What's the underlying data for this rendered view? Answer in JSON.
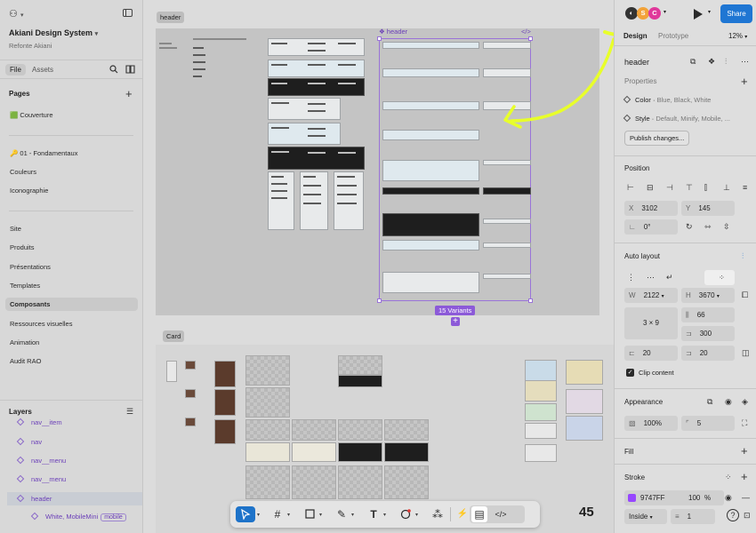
{
  "left_panel": {
    "logo": "⚇",
    "project_name": "Akiani Design System",
    "project_subtitle": "Refonte Akiani",
    "tabs": {
      "file": "File",
      "assets": "Assets"
    },
    "pages_header": "Pages",
    "pages": [
      {
        "label": "🟩 Couverture"
      },
      {
        "label": "🔑 01 - Fondamentaux"
      },
      {
        "label": "Couleurs"
      },
      {
        "label": "Iconographie"
      },
      {
        "label": "Site"
      },
      {
        "label": "Produits"
      },
      {
        "label": "Présentations"
      },
      {
        "label": "Templates"
      },
      {
        "label": "Composants"
      },
      {
        "label": "Ressources visuelles"
      },
      {
        "label": "Animation"
      },
      {
        "label": "Audit RAO"
      }
    ],
    "layers_header": "Layers",
    "layers": [
      {
        "label": "nav__item"
      },
      {
        "label": "nav"
      },
      {
        "label": "nav__menu"
      },
      {
        "label": "nav__menu"
      },
      {
        "label": "header"
      },
      {
        "label": "White, MobileMini",
        "tag": "mobile"
      }
    ]
  },
  "canvas": {
    "header_frame_label": "header",
    "selection_label": "❖ header",
    "code_icon": "</>",
    "variants_badge": "15 Variants",
    "card_frame_label": "Card",
    "zoom_count": "45"
  },
  "toolbar": {
    "tools": [
      "move-tool",
      "frame-tool",
      "shape-tool",
      "pen-tool",
      "text-tool",
      "comment-tool",
      "actions-tool"
    ]
  },
  "right_panel": {
    "avatars": [
      {
        "initial": "S",
        "color": "#f2a33a"
      },
      {
        "initial": "C",
        "color": "#e0399b"
      }
    ],
    "share_label": "Share",
    "tabs": {
      "design": "Design",
      "prototype": "Prototype"
    },
    "zoom": "12%",
    "component_name": "header",
    "properties_title": "Properties",
    "properties": [
      {
        "name": "Color",
        "values": "Blue, Black, White"
      },
      {
        "name": "Style",
        "values": "Default, Minify, Mobile, ..."
      }
    ],
    "publish_label": "Publish changes...",
    "position_title": "Position",
    "x_label": "X",
    "x_value": "3102",
    "y_label": "Y",
    "y_value": "145",
    "rotation_value": "0°",
    "auto_layout_title": "Auto layout",
    "w_label": "W",
    "w_value": "2122",
    "h_label": "H",
    "h_value": "3670",
    "grid_value": "3 × 9",
    "gap_value": "66",
    "padding_value": "300",
    "pad_left": "20",
    "pad_right": "20",
    "clip_content_label": "Clip content",
    "appearance_title": "Appearance",
    "opacity_value": "100%",
    "radius_value": "5",
    "fill_title": "Fill",
    "stroke_title": "Stroke",
    "stroke_color_hex": "9747FF",
    "stroke_color": "#9747FF",
    "stroke_opacity": "100",
    "stroke_pct": "%",
    "stroke_position": "Inside",
    "stroke_weight": "1",
    "help": "?"
  },
  "colors": {
    "accent": "#1f76d3",
    "selection": "#9a73d8",
    "annotation": "#e8ff2a"
  }
}
